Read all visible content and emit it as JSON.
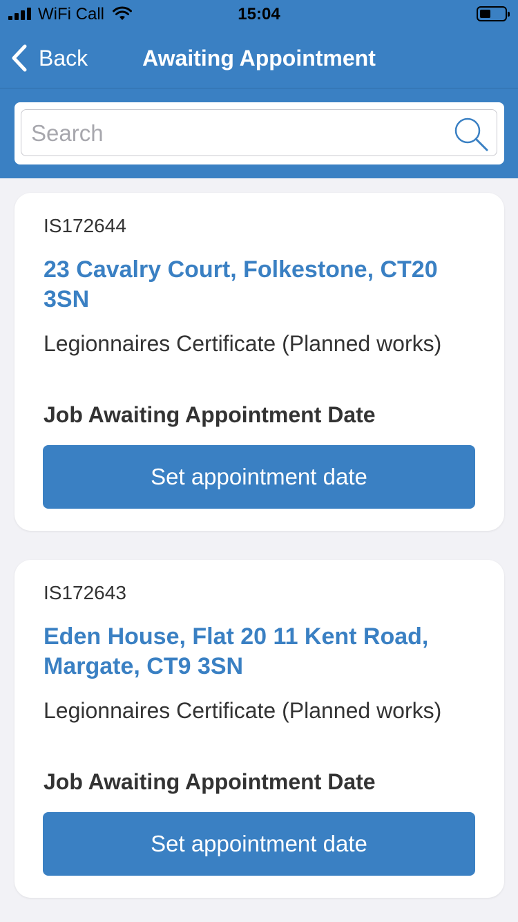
{
  "status_bar": {
    "carrier": "WiFi Call",
    "time": "15:04",
    "signal_icon": "signal-bars-icon",
    "wifi_icon": "wifi-icon",
    "battery_icon": "battery-icon"
  },
  "nav": {
    "back_label": "Back",
    "title": "Awaiting Appointment"
  },
  "search": {
    "placeholder": "Search",
    "value": "",
    "icon": "search-icon"
  },
  "jobs": [
    {
      "ref": "IS172644",
      "address": "23 Cavalry Court, Folkestone, CT20 3SN",
      "job_type": "Legionnaires Certificate (Planned works)",
      "status": "Job Awaiting Appointment Date",
      "action_label": "Set appointment date"
    },
    {
      "ref": "IS172643",
      "address": "Eden House, Flat 20 11 Kent Road, Margate, CT9 3SN",
      "job_type": "Legionnaires Certificate (Planned works)",
      "status": "Job Awaiting Appointment Date",
      "action_label": "Set appointment date"
    }
  ],
  "colors": {
    "brand": "#3a80c3",
    "background": "#f2f2f6",
    "card": "#ffffff",
    "text": "#333333"
  }
}
